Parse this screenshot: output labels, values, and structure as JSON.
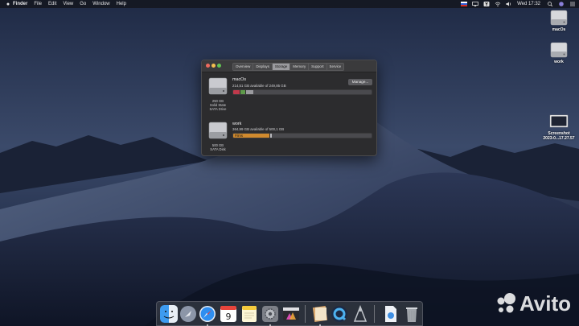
{
  "menubar": {
    "app_name": "Finder",
    "items": [
      "File",
      "Edit",
      "View",
      "Go",
      "Window",
      "Help"
    ],
    "clock": "Wed 17:32",
    "input_badge": "Y"
  },
  "desktop_icons": [
    {
      "label": "macOs"
    },
    {
      "label": "work"
    },
    {
      "label": "Screenshot",
      "label2": "2023-0...17.27.57"
    }
  ],
  "window": {
    "tabs": [
      "Overview",
      "Displays",
      "Storage",
      "Memory",
      "Support",
      "Service"
    ],
    "active_tab": "Storage",
    "manage_label": "Manage...",
    "drives": [
      {
        "name": "macOs",
        "available": "214,51 GB available of 249,85 GB",
        "caption": [
          "250 GB",
          "Solid State",
          "SATA Drive"
        ],
        "segments": [
          {
            "fraction": 0.045,
            "color": "#c0394b",
            "label": ""
          },
          {
            "fraction": 0.035,
            "color": "#5e9a4a",
            "label": ""
          },
          {
            "fraction": 0.055,
            "color": "#9b9b9f",
            "label": ""
          }
        ]
      },
      {
        "name": "work",
        "available": "364,99 GB available of 500,1 GB",
        "caption": [
          "500 GB",
          "SATA Disk"
        ],
        "segments": [
          {
            "fraction": 0.26,
            "color": "#d08a2e",
            "label": "Films"
          },
          {
            "fraction": 0.012,
            "color": "#b9b9bd",
            "label": ""
          }
        ]
      }
    ]
  },
  "dock": {
    "apps": [
      "finder",
      "launchpad",
      "safari",
      "calendar",
      "notes",
      "system-preferences",
      "final-cut-pro",
      "preview",
      "quicktime",
      "automator",
      "text-edit",
      "trash"
    ],
    "calendar_day": "9"
  },
  "watermark": {
    "text": "Avito"
  }
}
